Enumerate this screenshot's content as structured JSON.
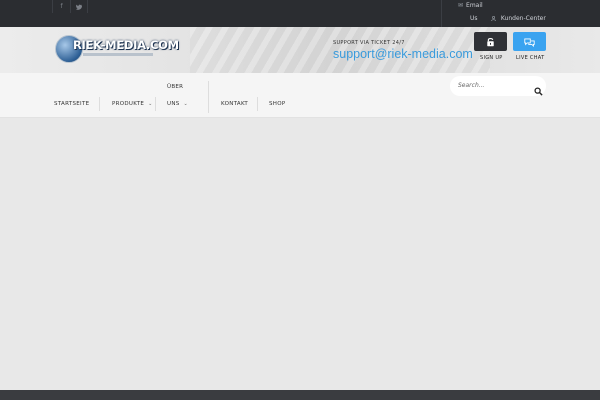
{
  "topbar": {
    "social": [
      {
        "name": "facebook",
        "glyph": "f"
      },
      {
        "name": "twitter",
        "glyph": "t"
      }
    ],
    "email_label_1": "Email",
    "email_label_2": "Us",
    "kunden_label": "Kunden-Center"
  },
  "header": {
    "logo_text": "RIEK-MEDIA.COM",
    "support_label": "SUPPORT VIA TICKET 24/7",
    "support_email": "support@riek-media.com",
    "signup_label": "SIGN UP",
    "chat_label": "LIVE CHAT",
    "accent_color": "#3aa3f0"
  },
  "nav": {
    "items": [
      {
        "label": "STARTSEITE"
      },
      {
        "label": "PRODUKTE"
      },
      {
        "label_line1": "ÜBER",
        "label_line2": "UNS"
      },
      {
        "label": "KONTAKT"
      },
      {
        "label": "SHOP"
      }
    ],
    "search_placeholder": "Search..."
  }
}
